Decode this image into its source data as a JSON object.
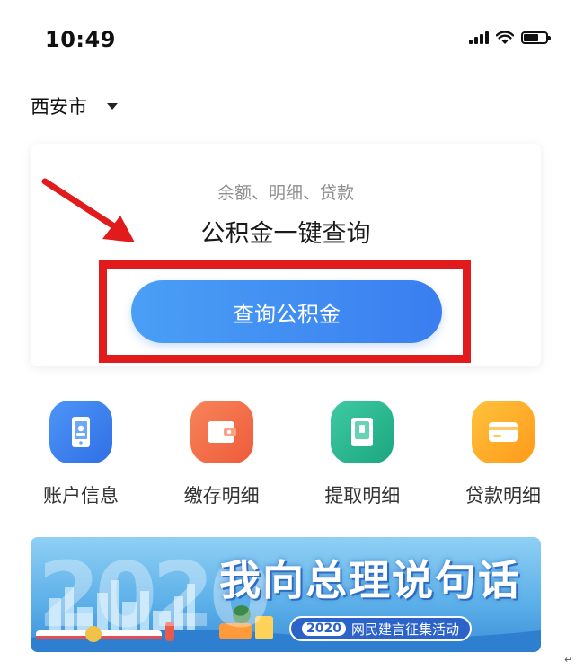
{
  "status_bar": {
    "time": "10:49"
  },
  "city_selector": {
    "label": "西安市",
    "icon": "chevron-down-icon"
  },
  "query_card": {
    "subtitle": "余额、明细、贷款",
    "title": "公积金一键查询",
    "button_label": "查询公积金"
  },
  "annotation": {
    "highlight_color": "#e11b1b"
  },
  "shortcuts": [
    {
      "label": "账户信息",
      "icon": "account-info-icon",
      "color": "#3f86f2"
    },
    {
      "label": "缴存明细",
      "icon": "wallet-icon",
      "color": "#f06f48"
    },
    {
      "label": "提取明细",
      "icon": "withdraw-icon",
      "color": "#23b38c"
    },
    {
      "label": "贷款明细",
      "icon": "card-icon",
      "color": "#ffab27"
    }
  ],
  "banner": {
    "title": "我向总理说句话",
    "pill_year": "2020",
    "pill_text": "网民建言征集活动"
  },
  "footer_mark": "↵",
  "colors": {
    "accent": "#3a7ef0",
    "banner_blue": "#5aaee8"
  }
}
